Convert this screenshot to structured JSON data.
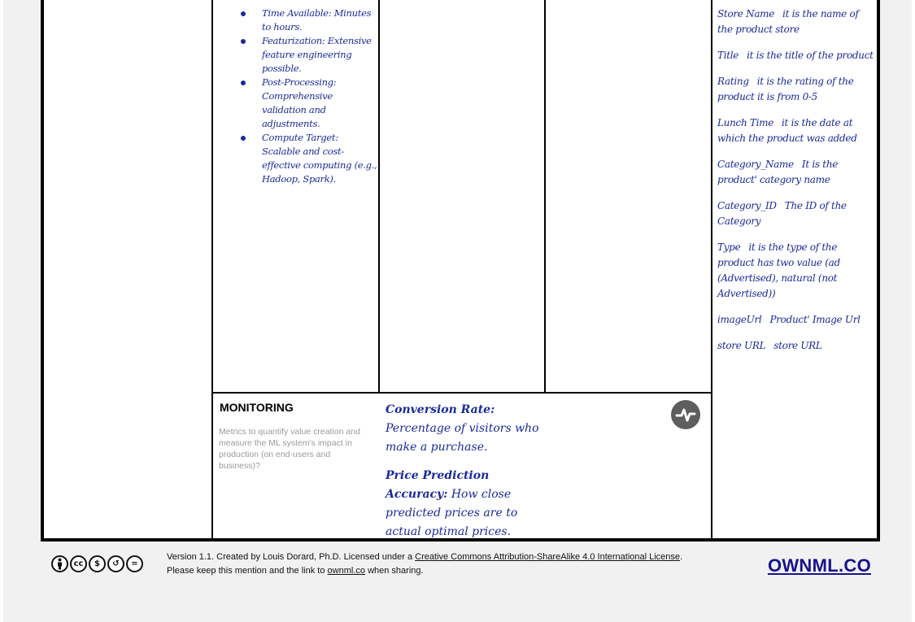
{
  "bullets": [
    {
      "text": "Time Available: Minutes to hours."
    },
    {
      "text": "Featurization: Extensive feature engineering possible."
    },
    {
      "text": "Post-Processing: Comprehensive validation and adjustments."
    },
    {
      "text": "Compute Target: Scalable and cost-effective computing (e.g., Hadoop, Spark)."
    }
  ],
  "features": [
    {
      "name": "Store Name",
      "desc": "it is the name of the product store"
    },
    {
      "name": "Title",
      "desc": "it is the title of the product"
    },
    {
      "name": "Rating",
      "desc": "it is the rating of the product it is from 0-5"
    },
    {
      "name": "Lunch Time",
      "desc": "it is the date at which the product was added"
    },
    {
      "name": "Category_Name",
      "desc": "It is the product' category name"
    },
    {
      "name": "Category_ID",
      "desc": "The ID of the Category"
    },
    {
      "name": "Type",
      "desc": "it is the type of the product has two value (ad (Advertised), natural (not Advertised))"
    },
    {
      "name": "imageUrl",
      "desc": "Product' Image Url"
    },
    {
      "name": "store URL",
      "desc": "store URL"
    }
  ],
  "monitoring": {
    "title": "MONITORING",
    "description": "Metrics to quantify value creation and measure the ML system's impact in production (on end-users and business)?",
    "icon": "activity-icon",
    "metrics": [
      {
        "label": "Conversion Rate:",
        "text": "Percentage of visitors who make a purchase."
      },
      {
        "label": "Price Prediction Accuracy:",
        "text": "How close predicted prices are to actual optimal prices."
      }
    ]
  },
  "footer": {
    "line1_prefix": "Version 1.1. Created by Louis Dorard, Ph.D. Licensed under a",
    "license_link": "Creative Commons Attribution-ShareAlike 4.0 International License",
    "line1_suffix": ".",
    "line2_prefix": "Please keep this mention and the link to",
    "site_link": "ownml.co",
    "line2_suffix": "when sharing.",
    "brand": "OWNML.CO",
    "cc_icons": [
      {
        "name": "cc-attribution-icon",
        "glyph": "i"
      },
      {
        "name": "cc-logo-icon",
        "glyph": "cc"
      },
      {
        "name": "cc-noncommercial-icon",
        "glyph": "$"
      },
      {
        "name": "cc-sharealike-icon",
        "glyph": "↺"
      },
      {
        "name": "cc-noderivs-icon",
        "glyph": "="
      }
    ]
  }
}
